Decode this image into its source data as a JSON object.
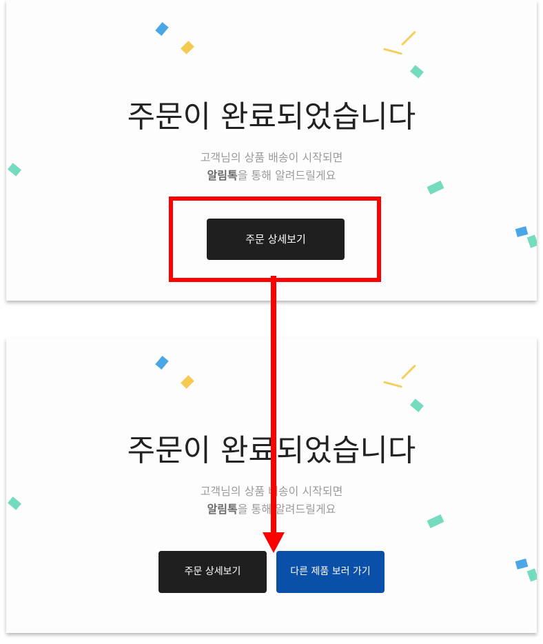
{
  "before": {
    "headline": "주문이 완료되었습니다",
    "subtext_line1": "고객님의 상품 배송이 시작되면",
    "subtext_line2_strong": "알림톡",
    "subtext_line2_rest": "을 통해 알려드릴게요",
    "order_detail_button": "주문 상세보기"
  },
  "after": {
    "headline": "주문이 완료되었습니다",
    "subtext_line1": "고객님의 상품 배송이 시작되면",
    "subtext_line2_strong": "알림톡",
    "subtext_line2_rest": "을 통해 알려드릴게요",
    "order_detail_button": "주문 상세보기",
    "browse_more_button": "다른 제품 보러 가기"
  },
  "annotation": {
    "highlight_color": "#ff0000",
    "arrow_color": "#ff0000"
  },
  "colors": {
    "dark_button": "#1f1f1f",
    "blue_button": "#0a4fa8",
    "confetti_blue": "#4aa6e6",
    "confetti_yellow": "#f5ca52",
    "confetti_green": "#74dbbf"
  }
}
